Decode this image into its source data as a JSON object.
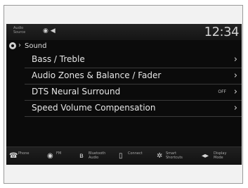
{
  "status_bar": {
    "audio_source_label": "Audio Source",
    "clock": "12:34"
  },
  "breadcrumb": {
    "title": "Sound"
  },
  "menu": [
    {
      "label": "Bass / Treble",
      "value": ""
    },
    {
      "label": "Audio Zones & Balance / Fader",
      "value": ""
    },
    {
      "label": "DTS Neural Surround",
      "value": "OFF"
    },
    {
      "label": "Speed Volume Compensation",
      "value": ""
    }
  ],
  "toolbar": {
    "phone": "Phone",
    "fm": "FM",
    "bluetooth_audio": "Bluetooth Audio",
    "connect": "Connect",
    "smart_shortcuts": "Smart Shortcuts",
    "display_mode": "Display Mode"
  },
  "icons": {
    "phone": "phone-icon",
    "fm": "radio-icon",
    "bluetooth": "bluetooth-icon",
    "connect": "device-icon",
    "shortcuts": "shortcuts-icon",
    "display": "display-mode-icon"
  }
}
